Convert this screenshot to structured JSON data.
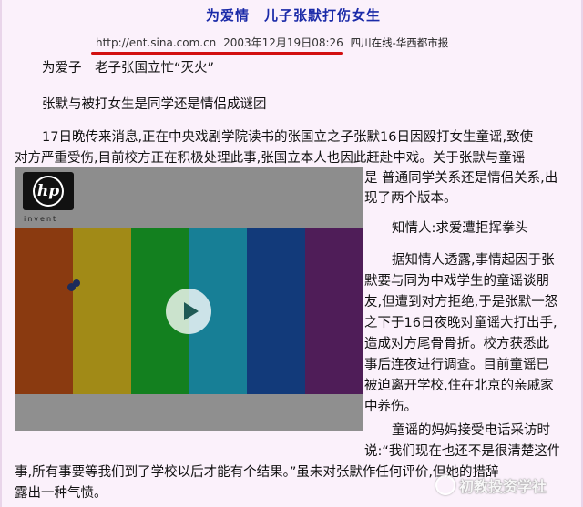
{
  "article": {
    "headline": "为爱情　儿子张默打伤女生",
    "source_url": "http://ent.sina.com.cn",
    "source_date": "2003年12月19日08:26",
    "source_outlet": "四川在线-华西都市报",
    "paragraphs": [
      "为爱子　老子张国立忙“灭火”",
      "张默与被打女生是同学还是情侣成谜团",
      "17日晚传来消息,正在中央戏剧学院读书的张国立之子张默16日因殴打女生童谣,致使",
      "对方严重受伤,目前校方正在积极处理此事,张国立本人也因此赶赴中戏。关于张默与童谣",
      "是 普通同学关系还是情侣关系,出",
      "现了两个版本。",
      "知情人:求爱遭拒挥拳头",
      "据知情人透露,事情起因于张",
      "默要与同为中戏学生的童谣谈朋",
      "友,但遭到对方拒绝,于是张默一怒",
      "之下于16日夜晚对童谣大打出手,",
      "造成对方尾骨骨折。校方获悉此",
      "事后连夜进行调查。目前童谣已",
      "被迫离开学校,住在北京的亲戚家",
      "中养伤。",
      "童谣的妈妈接受电话采访时",
      "说:“我们现在也还不是很清楚这件",
      "事,所有事要等我们到了学校以后才能有个结果。”虽未对张默作任何评价,但她的措辞",
      "露出一种气愤。"
    ]
  },
  "video": {
    "logo_text": "hp",
    "logo_tagline": "invent",
    "bar_colors": [
      "#8a3a10",
      "#a18a17",
      "#13801f",
      "#177f96",
      "#123a7a",
      "#4f1d58"
    ]
  },
  "watermark": {
    "text": "初教投资学社"
  },
  "colors": {
    "headline": "#1a2aa8",
    "underline": "#d21010",
    "background": "#fbf1fb"
  }
}
